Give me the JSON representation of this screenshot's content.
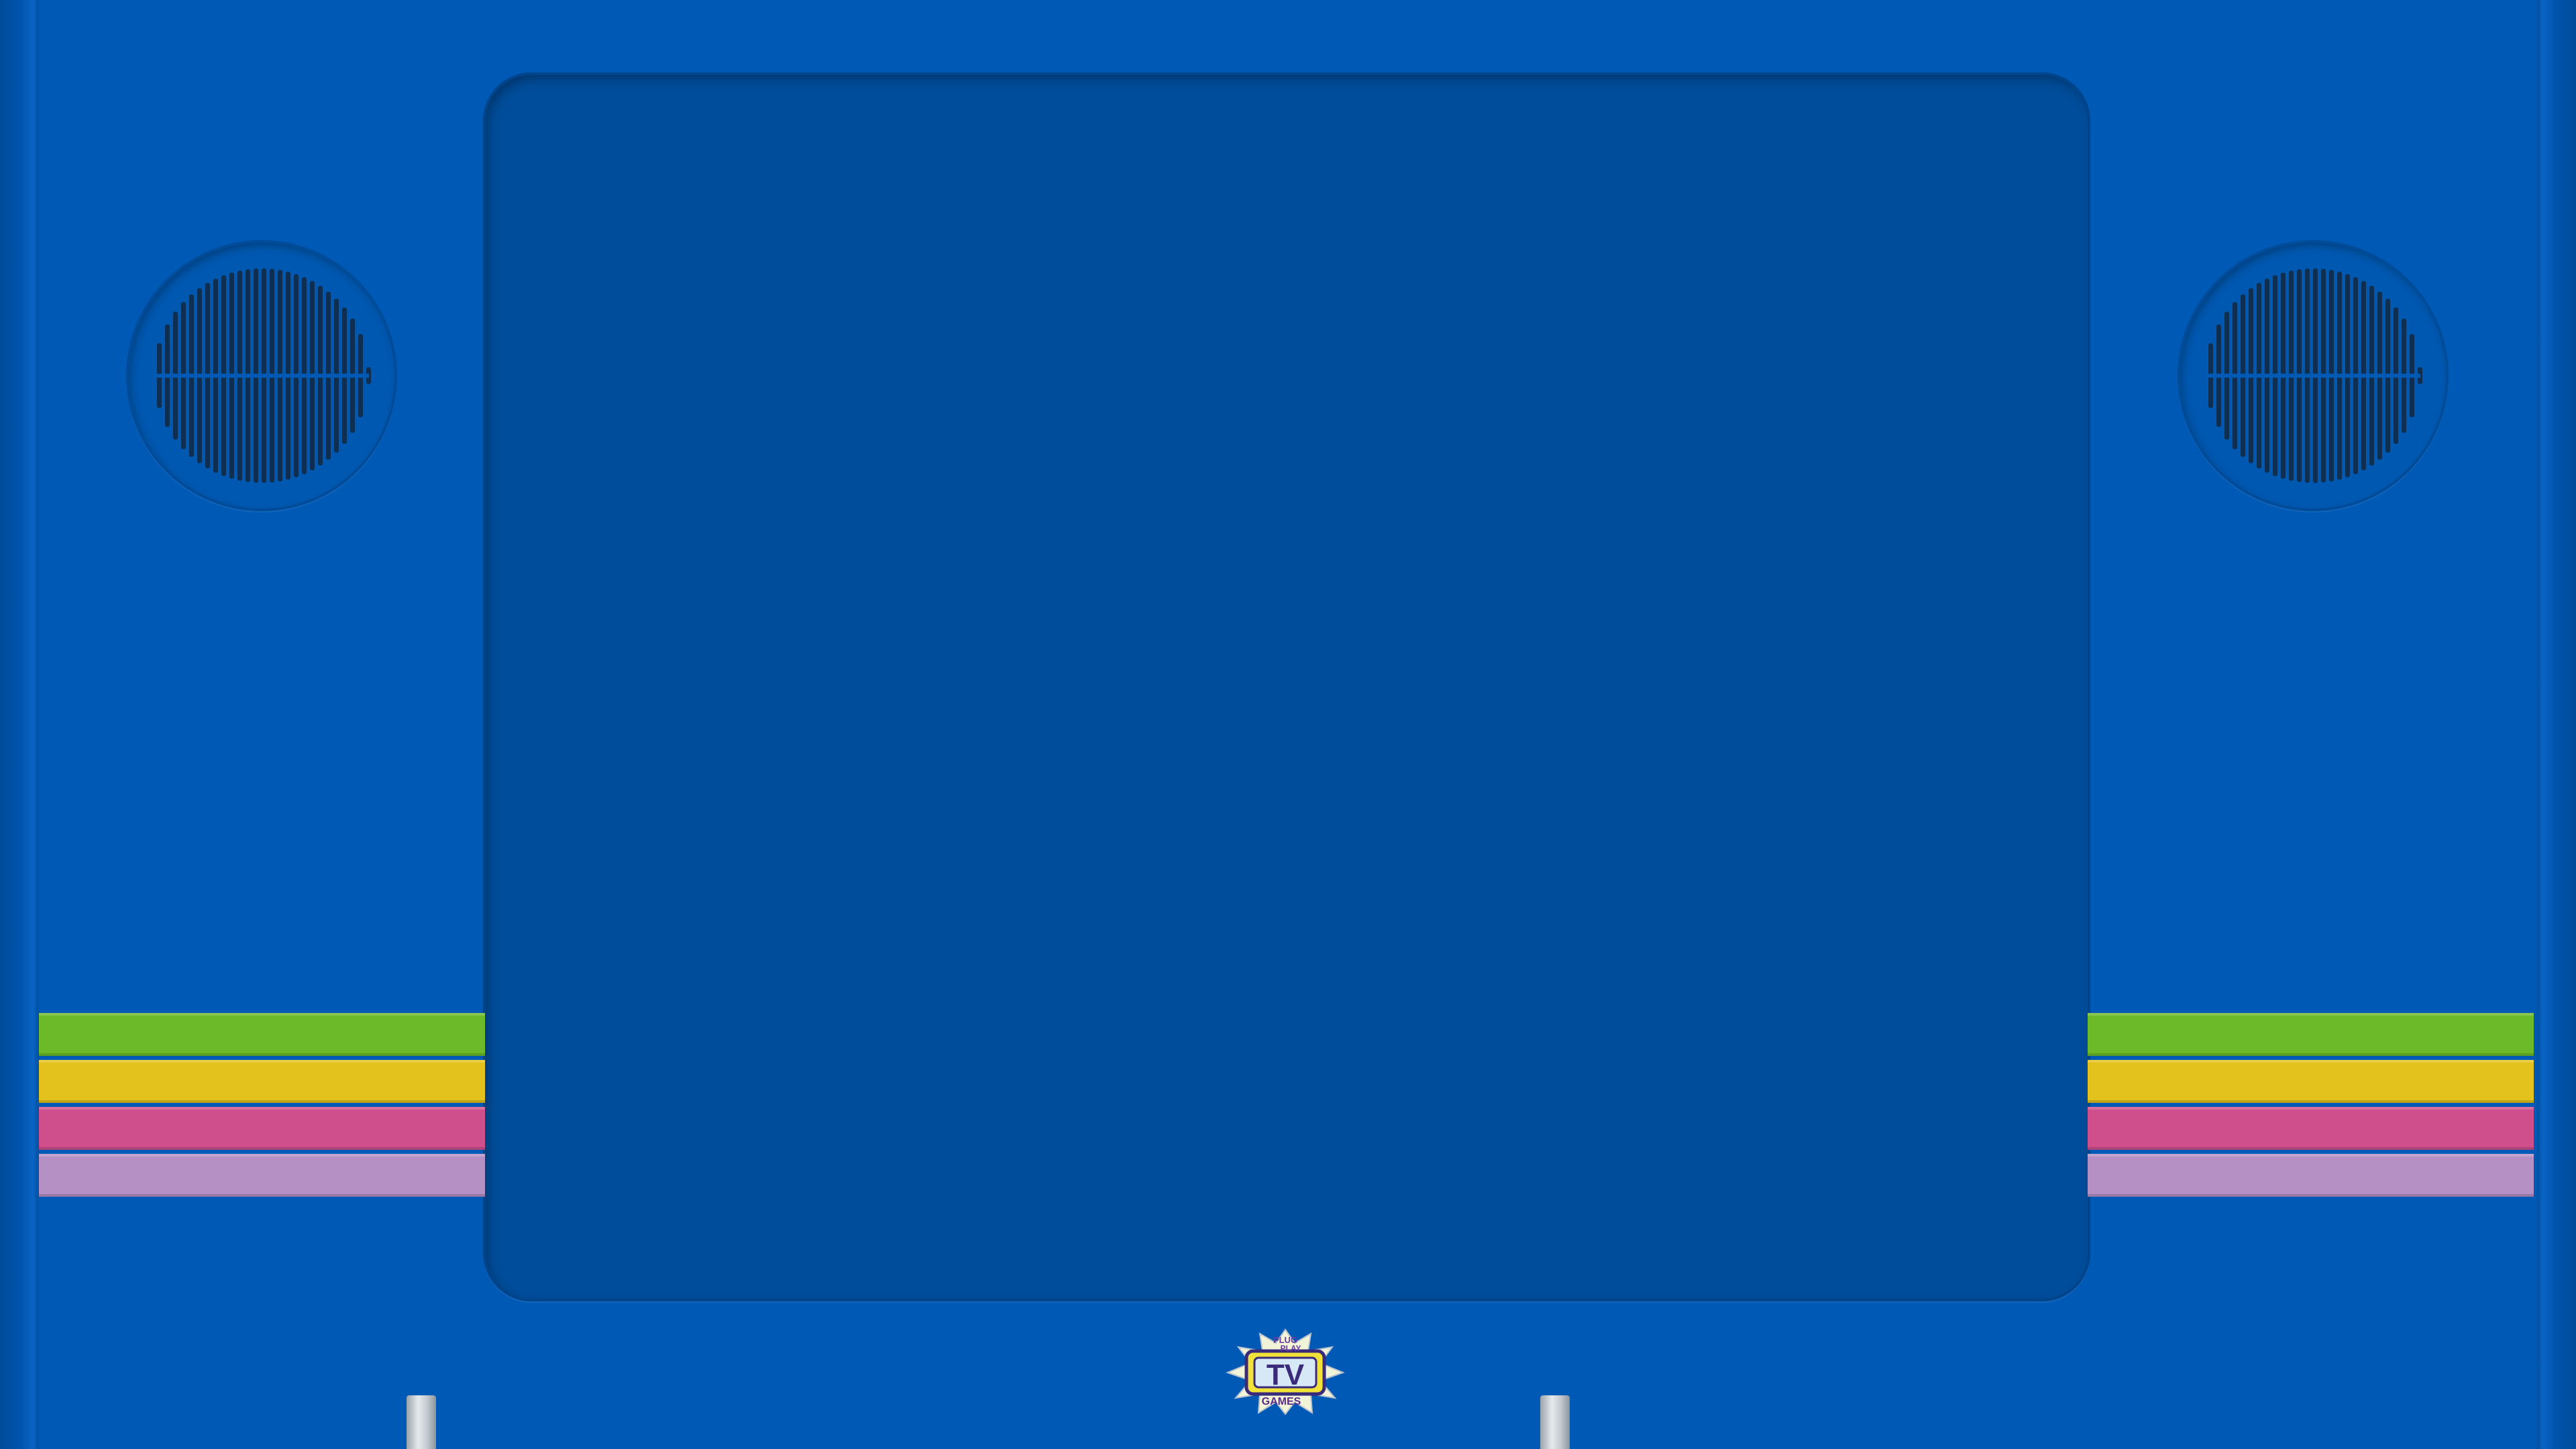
{
  "frame": {
    "body_color": "#005ab5",
    "screen_color": "#004d9b",
    "speaker_grille_color": "#0e2f52"
  },
  "stripes": {
    "colors": [
      "#6cba2a",
      "#e3c21d",
      "#cf4f8c",
      "#b490c4"
    ]
  },
  "logo": {
    "line1": "PLUG",
    "line2": "PLAY",
    "main": "TV",
    "line3": "GAMES"
  },
  "icons": {
    "speaker": "speaker-grille-icon",
    "logo": "plug-play-tv-games-logo"
  }
}
